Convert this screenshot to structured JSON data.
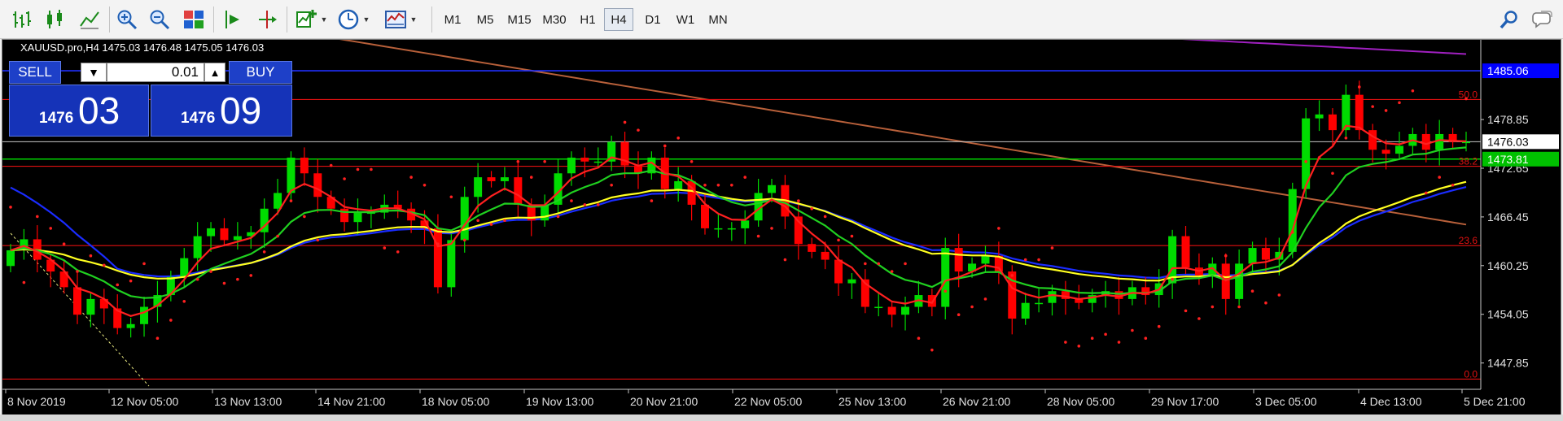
{
  "toolbar": {
    "timeframes": [
      "M1",
      "M5",
      "M15",
      "M30",
      "H1",
      "H4",
      "D1",
      "W1",
      "MN"
    ],
    "active_timeframe": "H4",
    "icons": [
      "bar-chart-icon",
      "candlestick-icon",
      "line-chart-icon",
      "zoom-in-icon",
      "zoom-out-icon",
      "tile-windows-icon",
      "autoscroll-icon",
      "chart-shift-icon",
      "new-indicator-icon",
      "periods-icon",
      "templates-icon",
      "search-icon",
      "chat-icon"
    ]
  },
  "chart": {
    "symbol_info": "XAUUSD.pro,H4  1475.03 1476.48 1475.05 1476.03",
    "one_click": {
      "sell_label": "SELL",
      "buy_label": "BUY",
      "volume": "0.01",
      "sell_prefix": "1476",
      "sell_big": "03",
      "buy_prefix": "1476",
      "buy_big": "09"
    },
    "price_axis": {
      "ticks": [
        "1478.85",
        "1472.65",
        "1466.45",
        "1460.25",
        "1454.05",
        "1447.85"
      ],
      "labels": [
        {
          "text": "1485.06",
          "price": 1485.06,
          "bg": "#0000ff",
          "fg": "#ffffff"
        },
        {
          "text": "1476.03",
          "price": 1476.03,
          "bg": "#ffffff",
          "fg": "#000000"
        },
        {
          "text": "1473.81",
          "price": 1473.81,
          "bg": "#00c000",
          "fg": "#ffffff"
        }
      ]
    },
    "fib_levels": [
      {
        "label": "50.0",
        "price": 1481.4
      },
      {
        "label": "38.2",
        "price": 1472.9
      },
      {
        "label": "23.6",
        "price": 1462.8
      },
      {
        "label": "0.0",
        "price": 1445.8
      }
    ],
    "time_axis": [
      "8 Nov 2019",
      "12 Nov 05:00",
      "13 Nov 13:00",
      "14 Nov 21:00",
      "18 Nov 05:00",
      "19 Nov 13:00",
      "20 Nov 21:00",
      "22 Nov 05:00",
      "25 Nov 13:00",
      "26 Nov 21:00",
      "28 Nov 05:00",
      "29 Nov 17:00",
      "3 Dec 05:00",
      "4 Dec 13:00",
      "5 Dec 21:00"
    ],
    "colors": {
      "background": "#000000",
      "bull": "#00dc00",
      "bear": "#ff0000",
      "ma_fast": "#ff2020",
      "ma_mid": "#20d020",
      "ma_slow": "#ffff20",
      "ma_blue": "#1a2cff",
      "ma_brown": "#b8603a",
      "ma_purple": "#a020c0",
      "sar": "#ff2020"
    }
  },
  "chart_data": {
    "type": "candlestick",
    "symbol": "XAUUSD.pro",
    "timeframe": "H4",
    "ylim": [
      1444.5,
      1489.0
    ],
    "x": [
      "8 Nov 2019",
      "12 Nov 05:00",
      "13 Nov 13:00",
      "14 Nov 21:00",
      "18 Nov 05:00",
      "19 Nov 13:00",
      "20 Nov 21:00",
      "22 Nov 05:00",
      "25 Nov 13:00",
      "26 Nov 21:00",
      "28 Nov 05:00",
      "29 Nov 17:00",
      "3 Dec 05:00",
      "4 Dec 13:00",
      "5 Dec 21:00"
    ],
    "closes": [
      1462.2,
      1463.6,
      1461.0,
      1459.5,
      1457.5,
      1454.0,
      1456.0,
      1454.8,
      1452.3,
      1452.8,
      1455.0,
      1456.5,
      1458.8,
      1461.2,
      1464.0,
      1465.0,
      1463.5,
      1464.0,
      1464.5,
      1467.5,
      1469.5,
      1474.0,
      1472.0,
      1469.0,
      1467.5,
      1465.8,
      1467.0,
      1467.0,
      1468.0,
      1467.5,
      1466.0,
      1465.0,
      1457.5,
      1463.5,
      1469.0,
      1471.5,
      1471.0,
      1471.5,
      1468.0,
      1466.0,
      1468.0,
      1472.0,
      1474.0,
      1473.5,
      1473.5,
      1476.0,
      1473.0,
      1472.0,
      1474.0,
      1470.0,
      1471.0,
      1468.0,
      1465.0,
      1465.0,
      1465.0,
      1466.0,
      1469.5,
      1470.5,
      1466.5,
      1463.0,
      1462.0,
      1461.0,
      1458.0,
      1458.5,
      1455.0,
      1455.0,
      1454.0,
      1455.0,
      1456.5,
      1455.0,
      1462.5,
      1459.5,
      1460.5,
      1461.5,
      1459.5,
      1453.5,
      1455.5,
      1455.5,
      1457.0,
      1456.0,
      1455.5,
      1456.5,
      1457.0,
      1456.0,
      1457.5,
      1456.5,
      1458.0,
      1464.0,
      1460.0,
      1459.0,
      1460.5,
      1456.0,
      1460.5,
      1462.5,
      1461.0,
      1462.0,
      1470.0,
      1479.0,
      1479.5,
      1477.5,
      1482.0,
      1477.5,
      1475.0,
      1474.5,
      1475.5,
      1477.0,
      1475.0,
      1477.0,
      1476.0,
      1476.0
    ],
    "moving_averages": [
      {
        "color": "red",
        "period": "fast"
      },
      {
        "color": "green",
        "period": "medium"
      },
      {
        "color": "yellow",
        "period": "slow"
      },
      {
        "color": "blue",
        "period": "long"
      },
      {
        "color": "brown",
        "period": "very long"
      },
      {
        "color": "purple",
        "period": "longest"
      }
    ],
    "indicators": [
      "Parabolic SAR",
      "Fibonacci retracement"
    ]
  }
}
